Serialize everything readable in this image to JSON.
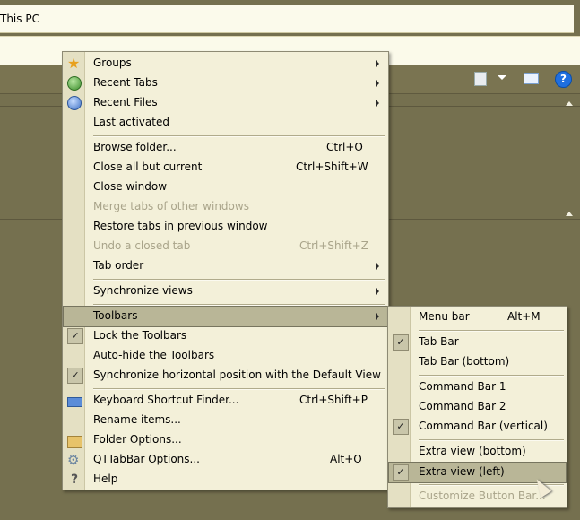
{
  "address": {
    "text": "This PC"
  },
  "main_menu": {
    "items": [
      {
        "label": "Groups",
        "shortcut": "",
        "submenu": true,
        "disabled": false,
        "icon": "star-icon"
      },
      {
        "label": "Recent Tabs",
        "shortcut": "",
        "submenu": true,
        "disabled": false,
        "icon": "recent-tabs-icon"
      },
      {
        "label": "Recent Files",
        "shortcut": "",
        "submenu": true,
        "disabled": false,
        "icon": "recent-files-icon"
      },
      {
        "label": "Last activated",
        "shortcut": "",
        "submenu": false,
        "disabled": false,
        "icon": ""
      },
      {
        "label": "Browse folder...",
        "shortcut": "Ctrl+O",
        "submenu": false,
        "disabled": false,
        "icon": ""
      },
      {
        "label": "Close all but current",
        "shortcut": "Ctrl+Shift+W",
        "submenu": false,
        "disabled": false,
        "icon": ""
      },
      {
        "label": "Close window",
        "shortcut": "",
        "submenu": false,
        "disabled": false,
        "icon": ""
      },
      {
        "label": "Merge tabs of other windows",
        "shortcut": "",
        "submenu": false,
        "disabled": true,
        "icon": ""
      },
      {
        "label": "Restore tabs in previous window",
        "shortcut": "",
        "submenu": false,
        "disabled": false,
        "icon": ""
      },
      {
        "label": "Undo a closed tab",
        "shortcut": "Ctrl+Shift+Z",
        "submenu": false,
        "disabled": true,
        "icon": ""
      },
      {
        "label": "Tab order",
        "shortcut": "",
        "submenu": true,
        "disabled": false,
        "icon": ""
      },
      {
        "label": "Synchronize views",
        "shortcut": "",
        "submenu": true,
        "disabled": false,
        "icon": ""
      },
      {
        "label": "Toolbars",
        "shortcut": "",
        "submenu": true,
        "disabled": false,
        "icon": "",
        "highlighted": true
      },
      {
        "label": "Lock the Toolbars",
        "shortcut": "",
        "submenu": false,
        "disabled": false,
        "checked": true
      },
      {
        "label": "Auto-hide the Toolbars",
        "shortcut": "",
        "submenu": false,
        "disabled": false
      },
      {
        "label": "Synchronize horizontal position with the Default View",
        "shortcut": "",
        "submenu": false,
        "disabled": false,
        "checked": true
      },
      {
        "label": "Keyboard Shortcut Finder...",
        "shortcut": "Ctrl+Shift+P",
        "submenu": false,
        "disabled": false,
        "icon": "keyboard-icon"
      },
      {
        "label": "Rename items...",
        "shortcut": "",
        "submenu": false,
        "disabled": false,
        "icon": ""
      },
      {
        "label": "Folder Options...",
        "shortcut": "",
        "submenu": false,
        "disabled": false,
        "icon": "folder-options-icon"
      },
      {
        "label": "QTTabBar Options...",
        "shortcut": "Alt+O",
        "submenu": false,
        "disabled": false,
        "icon": "gear-icon"
      },
      {
        "label": "Help",
        "shortcut": "",
        "submenu": false,
        "disabled": false,
        "icon": "help-icon"
      }
    ]
  },
  "toolbars_submenu": {
    "items": [
      {
        "label": "Menu bar",
        "shortcut": "Alt+M",
        "checked": false
      },
      {
        "label": "Tab Bar",
        "shortcut": "",
        "checked": true
      },
      {
        "label": "Tab Bar (bottom)",
        "shortcut": "",
        "checked": false
      },
      {
        "label": "Command Bar 1",
        "shortcut": "",
        "checked": false
      },
      {
        "label": "Command Bar 2",
        "shortcut": "",
        "checked": false
      },
      {
        "label": "Command Bar (vertical)",
        "shortcut": "",
        "checked": true
      },
      {
        "label": "Extra view (bottom)",
        "shortcut": "",
        "checked": false
      },
      {
        "label": "Extra view (left)",
        "shortcut": "",
        "checked": true,
        "highlighted": true
      },
      {
        "label": "Customize Button Bar...",
        "shortcut": "",
        "checked": false,
        "disabled": true
      }
    ]
  },
  "colors": {
    "background": "#75704f",
    "menu": "#f3f0d9",
    "highlight": "#b9b697"
  }
}
